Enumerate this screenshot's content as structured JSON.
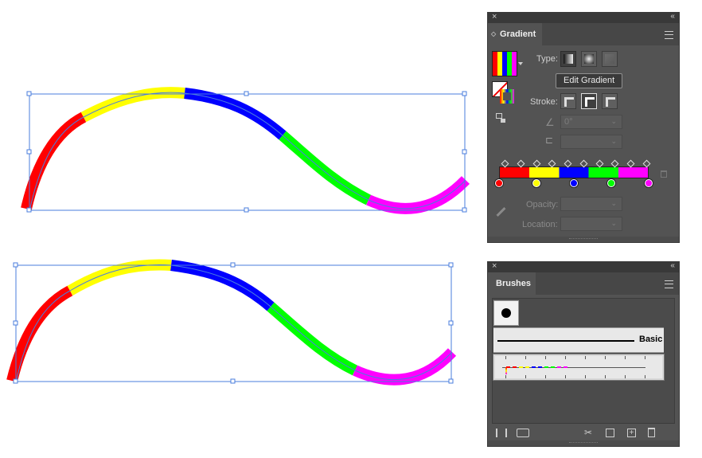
{
  "gradient_panel": {
    "close_glyph": "×",
    "collapse_glyph": "‹‹",
    "tab_label": "Gradient",
    "type_label": "Type:",
    "stroke_label": "Stroke:",
    "tooltip": "Edit Gradient",
    "angle_value": "0°",
    "opacity_label": "Opacity:",
    "location_label": "Location:",
    "stops": [
      "#ff0000",
      "#ffff00",
      "#0000ff",
      "#00ff00",
      "#ff00ff"
    ]
  },
  "brushes_panel": {
    "close_glyph": "×",
    "collapse_glyph": "‹‹",
    "tab_label": "Brushes",
    "basic_label": "Basic",
    "dash_colors": [
      "#ff0000",
      "#ffff00",
      "#0000ff",
      "#00ff00",
      "#ff00ff"
    ]
  },
  "canvas": {
    "segment_colors": [
      "#ff0000",
      "#ffff00",
      "#0000ff",
      "#00ff00",
      "#ff00ff"
    ],
    "selection_color": "#4a7dde"
  }
}
